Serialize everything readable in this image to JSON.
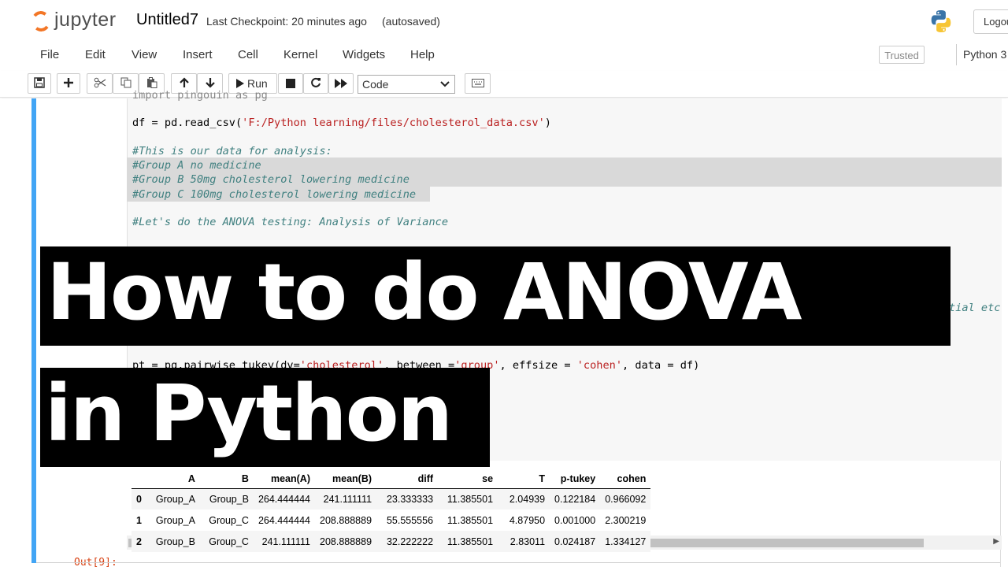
{
  "header": {
    "logo_text": "jupyter",
    "notebook_name": "Untitled7",
    "checkpoint": "Last Checkpoint: 20 minutes ago",
    "autosave": "(autosaved)",
    "logout_label": "Logou",
    "python_logo_icon": "python-logo-icon"
  },
  "menubar": {
    "items": [
      "File",
      "Edit",
      "View",
      "Insert",
      "Cell",
      "Kernel",
      "Widgets",
      "Help"
    ],
    "trusted_label": "Trusted",
    "kernel_label": "Python 3"
  },
  "toolbar": {
    "icons": [
      "save-icon",
      "add-cell-icon",
      "cut-icon",
      "copy-icon",
      "paste-icon",
      "move-up-icon",
      "move-down-icon",
      "run-icon",
      "stop-icon",
      "restart-icon",
      "fast-forward-icon",
      "keyboard-icon"
    ],
    "run_label": "Run",
    "cell_type": "Code"
  },
  "cell": {
    "line_top_partial": "import pingouin as pg",
    "line_read_prefix": "df = pd.read_csv(",
    "line_read_string": "'F:/Python learning/files/cholesterol_data.csv'",
    "line_read_suffix": ")",
    "comment1": "#This is our data for analysis:",
    "comment2": "#Group A no medicine",
    "comment3": "#Group B 50mg cholesterol lowering medicine",
    "comment4": "#Group C 100mg cholesterol lowering medicine",
    "comment5": "#Let's do the ANOVA testing: Analysis of Variance",
    "partial_right": "tial etc",
    "pt_prefix": "pt = pg.pairwise_tukey(dv=",
    "pt_str1": "'cholesterol'",
    "pt_mid1": ", between =",
    "pt_str2": "'group'",
    "pt_mid2": ", effsize = ",
    "pt_str3": "'cohen'",
    "pt_end": ", data = df)",
    "output_prompt": "Out[9]:"
  },
  "table": {
    "columns": [
      "",
      "A",
      "B",
      "mean(A)",
      "mean(B)",
      "diff",
      "se",
      "T",
      "p-tukey",
      "cohen"
    ],
    "rows": [
      [
        "0",
        "Group_A",
        "Group_B",
        "264.444444",
        "241.111111",
        "23.333333",
        "11.385501",
        "2.04939",
        "0.122184",
        "0.966092"
      ],
      [
        "1",
        "Group_A",
        "Group_C",
        "264.444444",
        "208.888889",
        "55.555556",
        "11.385501",
        "4.87950",
        "0.001000",
        "2.300219"
      ],
      [
        "2",
        "Group_B",
        "Group_C",
        "241.111111",
        "208.888889",
        "32.222222",
        "11.385501",
        "2.83011",
        "0.024187",
        "1.334127"
      ]
    ]
  },
  "overlay": {
    "line1": "How to do ANOVA",
    "line2": "in Python"
  },
  "colors": {
    "jupyter_orange": "#f37626",
    "cell_selected_bar": "#42a5f5",
    "string": "#ba2121",
    "comment": "#408080",
    "out_prompt": "#d84315"
  }
}
